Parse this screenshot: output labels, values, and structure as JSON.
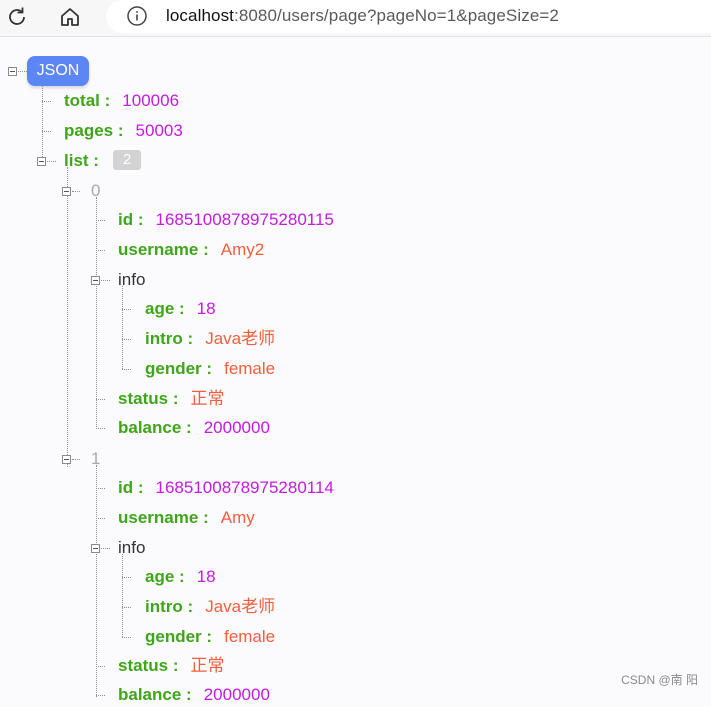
{
  "browser": {
    "url_host": "localhost",
    "url_rest": ":8080/users/page?pageNo=1&pageSize=2"
  },
  "root_label": "JSON",
  "fields": {
    "total_key": "total",
    "total_value": "100006",
    "pages_key": "pages",
    "pages_value": "50003",
    "list_key": "list",
    "list_count": "2"
  },
  "items": [
    {
      "index": "0",
      "id_key": "id",
      "id_value": "1685100878975280115",
      "username_key": "username",
      "username_value": "Amy2",
      "info_key": "info",
      "age_key": "age",
      "age_value": "18",
      "intro_key": "intro",
      "intro_value": "Java老师",
      "gender_key": "gender",
      "gender_value": "female",
      "status_key": "status",
      "status_value": "正常",
      "balance_key": "balance",
      "balance_value": "2000000"
    },
    {
      "index": "1",
      "id_key": "id",
      "id_value": "1685100878975280114",
      "username_key": "username",
      "username_value": "Amy",
      "info_key": "info",
      "age_key": "age",
      "age_value": "18",
      "intro_key": "intro",
      "intro_value": "Java老师",
      "gender_key": "gender",
      "gender_value": "female",
      "status_key": "status",
      "status_value": "正常",
      "balance_key": "balance",
      "balance_value": "2000000"
    }
  ],
  "colon": ":",
  "watermark": "CSDN @南 阳"
}
